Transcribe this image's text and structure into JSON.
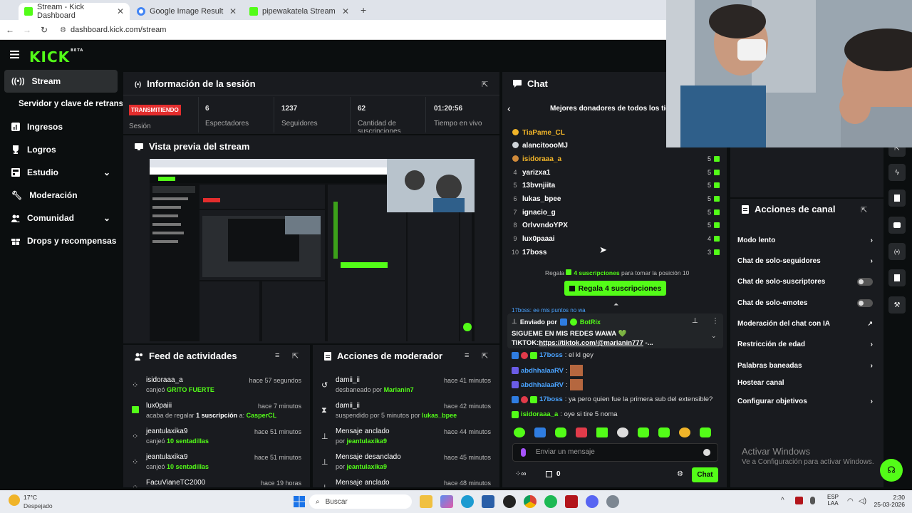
{
  "browser": {
    "tabs": [
      {
        "title": "Stream - Kick Dashboard"
      },
      {
        "title": "Google Image Result"
      },
      {
        "title": "pipewakatela Stream - Watch L"
      }
    ],
    "url": "dashboard.kick.com/stream"
  },
  "kick": {
    "logo": "KICK",
    "logo_badge": "BETA",
    "sidebar": [
      {
        "label": "Stream",
        "icon": "broadcast-icon"
      },
      {
        "label": "Servidor y clave de retransn",
        "icon": ""
      },
      {
        "label": "Ingresos",
        "icon": "chart-icon"
      },
      {
        "label": "Logros",
        "icon": "trophy-icon"
      },
      {
        "label": "Estudio",
        "icon": "layout-icon"
      },
      {
        "label": "Moderación",
        "icon": "wrench-icon"
      },
      {
        "label": "Comunidad",
        "icon": "people-icon"
      },
      {
        "label": "Drops y recompensas",
        "icon": "gift-icon"
      }
    ]
  },
  "session": {
    "title": "Información de la sesión",
    "status": "TRANSMITIENDO",
    "status_label": "Sesión",
    "stats": [
      {
        "value": "6",
        "label": "Espectadores"
      },
      {
        "value": "1237",
        "label": "Seguidores"
      },
      {
        "value": "62",
        "label": "Cantidad de suscripciones"
      },
      {
        "value": "01:20:56",
        "label": "Tiempo en vivo"
      }
    ]
  },
  "preview": {
    "title": "Vista previa del stream"
  },
  "feed": {
    "title": "Feed de actividades",
    "items": [
      {
        "name": "isidoraaa_a",
        "time": "hace 57 segundos",
        "pre": "canjeó ",
        "hl": "GRITO FUERTE",
        "post": "",
        "extra": "",
        "icon": "redeem-icon"
      },
      {
        "name": "lux0paiii",
        "time": "hace 7 minutos",
        "pre": "acaba de regalar ",
        "hl": "1 suscripción",
        "post": " a: ",
        "extra": "CasperCL",
        "icon": "gift-icon"
      },
      {
        "name": "jeantulaxika9",
        "time": "hace 51 minutos",
        "pre": "canjeó ",
        "hl": "10 sentadillas",
        "post": "",
        "extra": "",
        "icon": "redeem-icon"
      },
      {
        "name": "jeantulaxika9",
        "time": "hace 51 minutos",
        "pre": "canjeó ",
        "hl": "10 sentadillas",
        "post": "",
        "extra": "",
        "icon": "redeem-icon"
      },
      {
        "name": "FacuVianeTC2000",
        "time": "hace 19 horas",
        "pre": "",
        "hl": "",
        "post": "",
        "extra": "",
        "icon": "redeem-icon"
      }
    ]
  },
  "mod": {
    "title": "Acciones de moderador",
    "items": [
      {
        "name": "damii_ii",
        "time": "hace 41 minutos",
        "pre": "desbaneado por ",
        "hl": "Marianin7",
        "icon": "unban-icon"
      },
      {
        "name": "damii_ii",
        "time": "hace 42 minutos",
        "pre": "suspendido por 5 minutos por ",
        "hl": "lukas_bpee",
        "icon": "timer-icon"
      },
      {
        "name": "Mensaje anclado",
        "time": "hace 44 minutos",
        "pre": "por ",
        "hl": "jeantulaxika9",
        "icon": "pin-icon"
      },
      {
        "name": "Mensaje desanclado",
        "time": "hace 45 minutos",
        "pre": "por ",
        "hl": "jeantulaxika9",
        "icon": "unpin-icon"
      },
      {
        "name": "Mensaje anclado",
        "time": "hace 48 minutos",
        "pre": "",
        "hl": "",
        "icon": "pin-icon"
      }
    ]
  },
  "chat": {
    "title": "Chat",
    "leaderboard_title": "Mejores donadores de todos los tiem",
    "donors": [
      {
        "rank": "",
        "name": "TiaPame_CL",
        "count": "",
        "color": "#f0b429"
      },
      {
        "rank": "",
        "name": "alancitoooMJ",
        "count": "",
        "color": "#ffffff"
      },
      {
        "rank": "",
        "name": "isidoraaa_a",
        "count": "5",
        "color": "#f0b429"
      },
      {
        "rank": "4",
        "name": "yarizxa1",
        "count": "5",
        "color": "#ffffff"
      },
      {
        "rank": "5",
        "name": "13bvnjiita",
        "count": "5",
        "color": "#ffffff"
      },
      {
        "rank": "6",
        "name": "lukas_bpee",
        "count": "5",
        "color": "#ffffff"
      },
      {
        "rank": "7",
        "name": "ignacio_g",
        "count": "5",
        "color": "#ffffff"
      },
      {
        "rank": "8",
        "name": "OrlvvndoYPX",
        "count": "5",
        "color": "#ffffff"
      },
      {
        "rank": "9",
        "name": "lux0paaai",
        "count": "4",
        "color": "#ffffff"
      },
      {
        "rank": "10",
        "name": "17boss",
        "count": "3",
        "color": "#ffffff"
      }
    ],
    "gift_cta_pre": "Regala ",
    "gift_cta_hl": "4 suscripciones",
    "gift_cta_post": " para tomar la posición 10",
    "gift_button": "Regala 4 suscripciones",
    "scroll_snippet": "17boss: ee mis puntos no wa",
    "pinned_by_label": "Enviado por",
    "pinned_by": "BotRix",
    "pinned_line1": "SIGUEME EN MIS REDES WAWA 💚",
    "pinned_line2_pre": "TIKTOK:",
    "pinned_link": "https://tiktok.com/@marianin777",
    "pinned_line2_post": " -...",
    "messages": [
      {
        "user": "17boss",
        "text": ": el kl gey",
        "ucolor": "#4aa3ff"
      },
      {
        "user": "abdhhalaaRV",
        "text": ":",
        "ucolor": "#4aa3ff"
      },
      {
        "user": "abdhhalaaRV",
        "text": ":",
        "ucolor": "#4aa3ff"
      },
      {
        "user": "17boss",
        "text": ": ya pero quien fue la primera sub del extensible?",
        "ucolor": "#4aa3ff"
      },
      {
        "user": "isidoraaa_a",
        "text": ": oye si tire 5 noma",
        "ucolor": "#53fc18"
      }
    ],
    "input_placeholder": "Enviar un mensaje",
    "points": "0",
    "send_button": "Chat"
  },
  "channel_actions": {
    "title": "Acciones de canal",
    "items": [
      {
        "label": "Modo lento",
        "ctrl": "chevron"
      },
      {
        "label": "Chat de solo-seguidores",
        "ctrl": "chevron"
      },
      {
        "label": "Chat de solo-suscriptores",
        "ctrl": "toggle"
      },
      {
        "label": "Chat de solo-emotes",
        "ctrl": "toggle"
      },
      {
        "label": "Moderación del chat con IA",
        "ctrl": "external"
      },
      {
        "label": "Restricción de edad",
        "ctrl": "chevron"
      },
      {
        "label": "Palabras baneadas",
        "ctrl": "chevron"
      },
      {
        "label": "Hostear canal",
        "ctrl": "none"
      },
      {
        "label": "Configurar objetivos",
        "ctrl": "chevron"
      }
    ]
  },
  "activate_windows": {
    "title": "Activar Windows",
    "sub": "Ve a Configuración para activar Windows."
  },
  "taskbar": {
    "weather_temp": "17°C",
    "weather_text": "Despejado",
    "search": "Buscar",
    "lang1": "ESP",
    "lang2": "LAA",
    "time": "2:30",
    "date": "25-03-2026"
  }
}
